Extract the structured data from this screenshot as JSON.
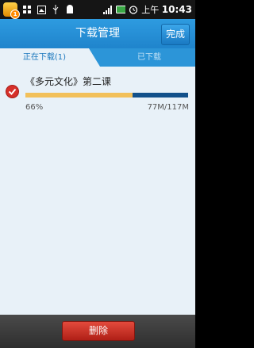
{
  "status_bar": {
    "time_prefix": "上午",
    "time": "10:43"
  },
  "header": {
    "title": "下载管理",
    "done_label": "完成"
  },
  "tabs": [
    {
      "label": "正在下载(1)",
      "active": true
    },
    {
      "label": "已下载",
      "active": false
    }
  ],
  "downloads": [
    {
      "title": "《多元文化》第二课",
      "progress_percent": 66,
      "progress_text": "66%",
      "size_text": "77M/117M",
      "checked": true
    }
  ],
  "footer": {
    "delete_label": "删除"
  },
  "colors": {
    "accent": "#1f84cc",
    "progress_fill": "#f2c05a",
    "progress_track": "#12508a",
    "delete": "#c8281e"
  }
}
